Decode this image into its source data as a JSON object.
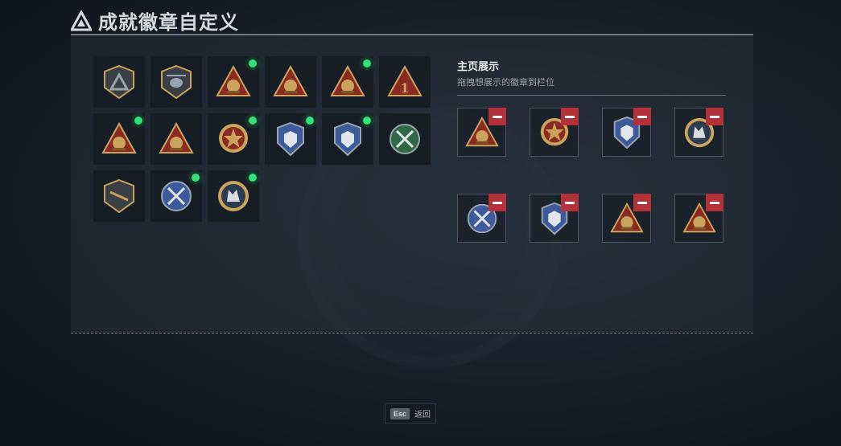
{
  "header": {
    "title": "成就徽章自定义",
    "icon": "triangle-logo-icon"
  },
  "inventory": {
    "badges": [
      {
        "icon": "shield-triangle-badge-icon",
        "new": false
      },
      {
        "icon": "helicopter-badge-icon",
        "new": false
      },
      {
        "icon": "gold-triangle-gate-badge-icon",
        "new": true
      },
      {
        "icon": "gold-triangle-soldiers-badge-icon",
        "new": false
      },
      {
        "icon": "gold-triangle-helmet-badge-icon",
        "new": true
      },
      {
        "icon": "red-triangle-number-one-badge-icon",
        "new": false
      },
      {
        "icon": "gold-triangle-emblem-badge-icon",
        "new": true
      },
      {
        "icon": "gold-triangle-squad-badge-icon",
        "new": false
      },
      {
        "icon": "red-star-medal-badge-icon",
        "new": true
      },
      {
        "icon": "blue-police-shield-badge-icon",
        "new": true
      },
      {
        "icon": "blue-eagle-shield-badge-icon",
        "new": true
      },
      {
        "icon": "green-crossed-rifles-badge-icon",
        "new": false
      },
      {
        "icon": "shield-rifle-badge-icon",
        "new": false
      },
      {
        "icon": "blue-crossed-rifles-badge-icon",
        "new": true
      },
      {
        "icon": "wolf-round-badge-icon",
        "new": true
      }
    ]
  },
  "showcase": {
    "title": "主页展示",
    "subtitle": "拖拽想展示的徽章到栏位",
    "slots": [
      {
        "icon": "gold-triangle-emblem-badge-icon"
      },
      {
        "icon": "red-star-medal-badge-icon"
      },
      {
        "icon": "blue-police-shield-badge-icon"
      },
      {
        "icon": "wolf-round-badge-icon"
      },
      {
        "icon": "blue-crossed-rifles-badge-icon"
      },
      {
        "icon": "blue-eagle-shield-badge-icon"
      },
      {
        "icon": "gold-triangle-helmet-badge-icon"
      },
      {
        "icon": "gold-triangle-gate-badge-icon"
      }
    ]
  },
  "footer": {
    "esc_key": "Esc",
    "esc_label": "返回"
  },
  "colors": {
    "new_dot": "#35e07a",
    "remove": "#b3323a",
    "gold": "#c9a45a"
  }
}
